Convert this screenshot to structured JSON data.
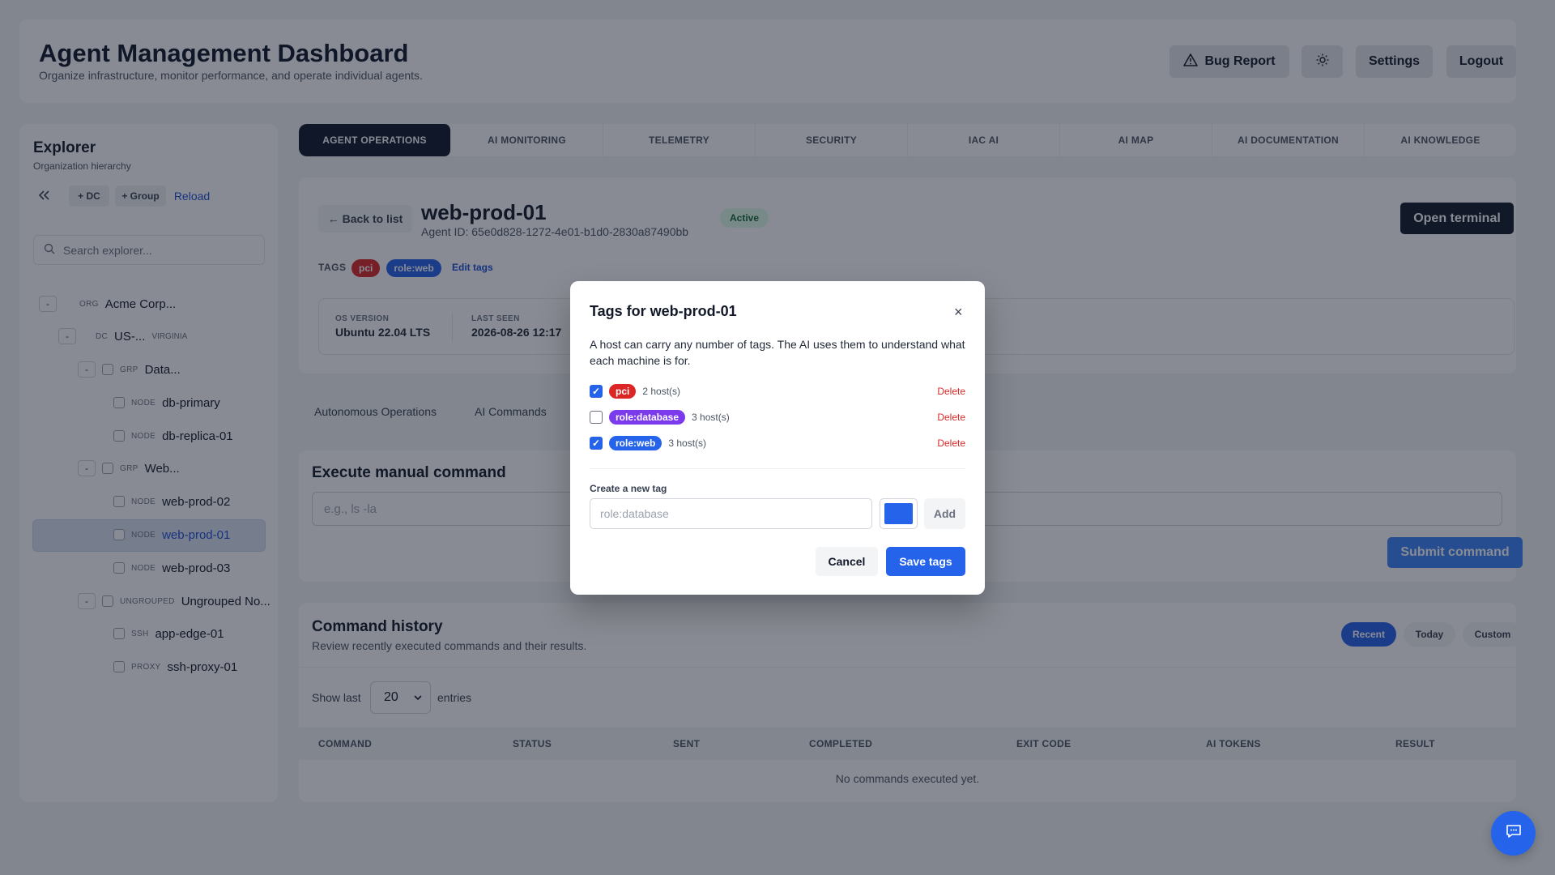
{
  "header": {
    "title": "Agent Management Dashboard",
    "subtitle": "Organize infrastructure, monitor performance, and operate individual agents.",
    "bug_report": "Bug Report",
    "settings": "Settings",
    "logout": "Logout"
  },
  "explorer": {
    "title": "Explorer",
    "subtitle": "Organization hierarchy",
    "add_dc": "+ DC",
    "add_group": "+ Group",
    "reload": "Reload",
    "search_placeholder": "Search explorer...",
    "tree": [
      {
        "toggle": "-",
        "kind": "ORG",
        "name": "Acme Corp..."
      },
      {
        "toggle": "-",
        "kind": "DC",
        "name": "US-...",
        "region": "VIRGINIA"
      },
      {
        "toggle": "-",
        "kind": "GRP",
        "name": "Data..."
      },
      {
        "kind": "NODE",
        "name": "db-primary"
      },
      {
        "kind": "NODE",
        "name": "db-replica-01"
      },
      {
        "toggle": "-",
        "kind": "GRP",
        "name": "Web..."
      },
      {
        "kind": "NODE",
        "name": "web-prod-02"
      },
      {
        "kind": "NODE",
        "name": "web-prod-01"
      },
      {
        "kind": "NODE",
        "name": "web-prod-03"
      },
      {
        "toggle": "-",
        "kind": "UNGROUPED",
        "name": "Ungrouped No..."
      },
      {
        "kind": "SSH",
        "name": "app-edge-01"
      },
      {
        "kind": "PROXY",
        "name": "ssh-proxy-01"
      }
    ]
  },
  "tabs": [
    "AGENT OPERATIONS",
    "AI MONITORING",
    "TELEMETRY",
    "SECURITY",
    "IAC AI",
    "AI MAP",
    "AI DOCUMENTATION",
    "AI KNOWLEDGE"
  ],
  "agent": {
    "back": "← Back to list",
    "name": "web-prod-01",
    "id_text": "Agent ID: 65e0d828-1272-4e01-b1d0-2830a87490bb",
    "status": "Active",
    "open_terminal": "Open terminal",
    "tags_label": "TAGS",
    "tags": [
      {
        "label": "pci",
        "color": "#dc2626"
      },
      {
        "label": "role:web",
        "color": "#2563eb"
      }
    ],
    "edit_tags": "Edit tags",
    "os_label": "OS VERSION",
    "os_value": "Ubuntu 22.04 LTS",
    "seen_label": "LAST SEEN",
    "seen_value": "2026-08-26 12:17"
  },
  "subtabs": [
    "Autonomous Operations",
    "AI Commands"
  ],
  "exec": {
    "title": "Execute manual command",
    "placeholder": "e.g., ls -la",
    "submit": "Submit command"
  },
  "history": {
    "title": "Command history",
    "subtitle": "Review recently executed commands and their results.",
    "filters": [
      "Recent",
      "Today",
      "Custom"
    ],
    "show_last": "Show last",
    "count": "20",
    "entries": "entries",
    "columns": [
      "COMMAND",
      "STATUS",
      "SENT",
      "COMPLETED",
      "EXIT CODE",
      "AI TOKENS",
      "RESULT"
    ],
    "empty": "No commands executed yet."
  },
  "modal": {
    "title": "Tags for web-prod-01",
    "close": "×",
    "description": "A host can carry any number of tags. The AI uses them to understand what each machine is for.",
    "tags": [
      {
        "label": "pci",
        "hosts": "2 host(s)",
        "checked": true,
        "color": "#dc2626"
      },
      {
        "label": "role:database",
        "hosts": "3 host(s)",
        "checked": false,
        "color": "#7c3aed"
      },
      {
        "label": "role:web",
        "hosts": "3 host(s)",
        "checked": true,
        "color": "#2563eb"
      }
    ],
    "delete": "Delete",
    "create_label": "Create a new tag",
    "input_placeholder": "role:database",
    "color": "#2563eb",
    "add": "Add",
    "cancel": "Cancel",
    "save": "Save tags"
  }
}
